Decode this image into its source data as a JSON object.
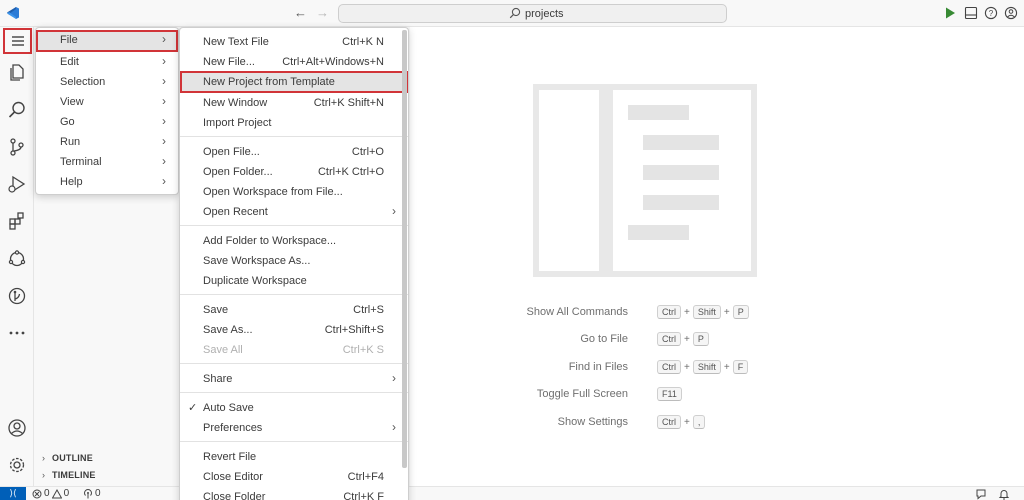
{
  "titlebar": {
    "search_text": "projects",
    "back_icon": "arrow-left-icon",
    "forward_icon": "arrow-right-icon",
    "run_icon": "play-icon",
    "layout_icon": "panel-layout-icon",
    "help_icon": "help-circle-icon",
    "account_icon": "account-circle-icon"
  },
  "activity_bar": {
    "items": [
      "menu-icon",
      "explorer-icon",
      "search-icon",
      "source-control-icon",
      "run-debug-icon",
      "extensions-icon",
      "remote-explorer-icon",
      "gitlens-icon",
      "more-icon",
      "accounts-icon",
      "manage-gear-icon"
    ]
  },
  "sidebar": {
    "sections": [
      {
        "label": "OUTLINE"
      },
      {
        "label": "TIMELINE"
      }
    ]
  },
  "main_menu": {
    "items": [
      {
        "label": "File"
      },
      {
        "label": "Edit"
      },
      {
        "label": "Selection"
      },
      {
        "label": "View"
      },
      {
        "label": "Go"
      },
      {
        "label": "Run"
      },
      {
        "label": "Terminal"
      },
      {
        "label": "Help"
      }
    ]
  },
  "file_menu": {
    "items": [
      {
        "label": "New Text File",
        "key": "Ctrl+K N"
      },
      {
        "label": "New File...",
        "key": "Ctrl+Alt+Windows+N"
      },
      {
        "label": "New Project from Template",
        "key": ""
      },
      {
        "label": "New Window",
        "key": "Ctrl+K Shift+N"
      },
      {
        "label": "Import Project",
        "key": ""
      },
      {
        "label": "Open File...",
        "key": "Ctrl+O"
      },
      {
        "label": "Open Folder...",
        "key": "Ctrl+K Ctrl+O"
      },
      {
        "label": "Open Workspace from File...",
        "key": ""
      },
      {
        "label": "Open Recent",
        "key": ""
      },
      {
        "label": "Add Folder to Workspace...",
        "key": ""
      },
      {
        "label": "Save Workspace As...",
        "key": ""
      },
      {
        "label": "Duplicate Workspace",
        "key": ""
      },
      {
        "label": "Save",
        "key": "Ctrl+S"
      },
      {
        "label": "Save As...",
        "key": "Ctrl+Shift+S"
      },
      {
        "label": "Save All",
        "key": "Ctrl+K S"
      },
      {
        "label": "Share",
        "key": ""
      },
      {
        "label": "Auto Save",
        "key": ""
      },
      {
        "label": "Preferences",
        "key": ""
      },
      {
        "label": "Revert File",
        "key": ""
      },
      {
        "label": "Close Editor",
        "key": "Ctrl+F4"
      },
      {
        "label": "Close Folder",
        "key": "Ctrl+K F"
      }
    ],
    "auto_save_checked": true
  },
  "welcome": {
    "shortcuts": [
      {
        "label": "Show All Commands",
        "keys": [
          "Ctrl",
          "Shift",
          "P"
        ]
      },
      {
        "label": "Go to File",
        "keys": [
          "Ctrl",
          "P"
        ]
      },
      {
        "label": "Find in Files",
        "keys": [
          "Ctrl",
          "Shift",
          "F"
        ]
      },
      {
        "label": "Toggle Full Screen",
        "keys": [
          "F11"
        ]
      },
      {
        "label": "Show Settings",
        "keys": [
          "Ctrl",
          ","
        ]
      }
    ],
    "plus": "+"
  },
  "statusbar": {
    "remote_icon": "remote-indicator-icon",
    "errors": "0",
    "warnings": "0",
    "ports": "0",
    "feedback_icon": "feedback-icon",
    "bell_icon": "bell-icon"
  },
  "colors": {
    "accent": "#005fb8",
    "highlight_box": "#d13438",
    "menu_hover": "#e4e4e4"
  }
}
